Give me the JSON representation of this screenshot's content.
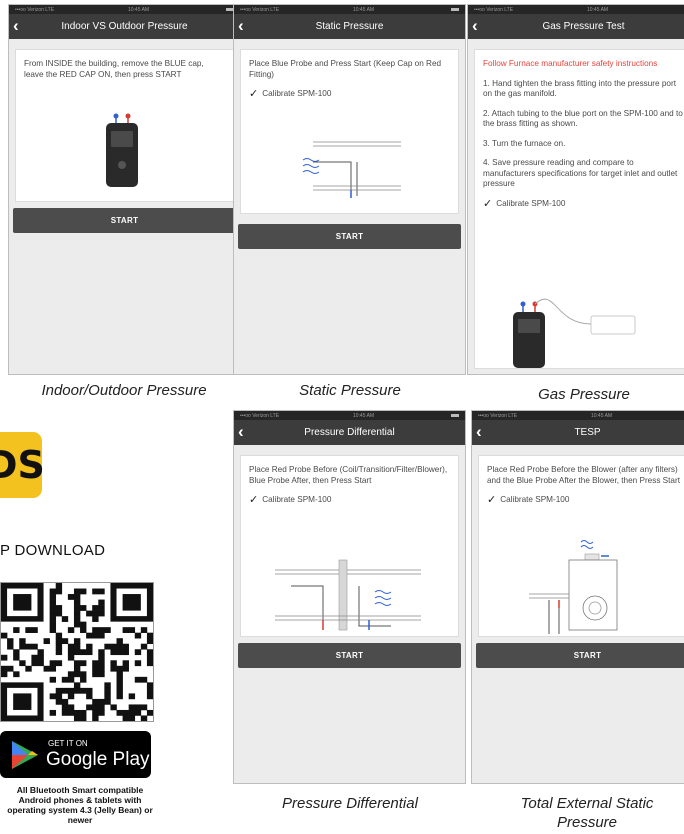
{
  "status_bar": {
    "carrier": "•••oo Verizon LTE",
    "time": "10:45 AM",
    "battery": "∗"
  },
  "screens": {
    "indoor_outdoor": {
      "title": "Indoor VS Outdoor Pressure",
      "instruction": "From INSIDE the building, remove the BLUE cap, leave the RED CAP ON, then press START",
      "button": "START",
      "caption": "Indoor/Outdoor Pressure"
    },
    "static_pressure": {
      "title": "Static Pressure",
      "instruction": "Place Blue Probe and Press Start (Keep Cap on Red Fitting)",
      "calibrate": "Calibrate SPM-100",
      "button": "START",
      "caption": "Static Pressure"
    },
    "gas_pressure": {
      "title": "Gas Pressure Test",
      "warning": "Follow Furnace manufacturer safety instructions",
      "steps": [
        "1. Hand tighten the brass fitting into the pressure port on the gas manifold.",
        "2. Attach tubing to the blue port on the SPM-100 and to the brass fitting as shown.",
        "3. Turn the furnace on.",
        "4. Save pressure reading and compare to manufacturers specifications for target inlet and outlet pressure"
      ],
      "calibrate": "Calibrate SPM-100",
      "caption": "Gas Pressure"
    },
    "pressure_differential": {
      "title": "Pressure Differential",
      "instruction": "Place Red Probe Before (Coil/Transition/Filter/Blower), Blue Probe After, then Press Start",
      "calibrate": "Calibrate SPM-100",
      "button": "START",
      "caption": "Pressure Differential"
    },
    "tesp": {
      "title": "TESP",
      "instruction": "Place Red Probe Before the Blower (after any filters) and the Blue Probe After the Blower, then Press Start",
      "calibrate": "Calibrate SPM-100",
      "button": "START",
      "caption_line1": "Total External Static",
      "caption_line2": "Pressure"
    }
  },
  "download": {
    "badge_text": "DS",
    "heading": "P DOWNLOAD",
    "google_play_small": "GET IT ON",
    "google_play_big": "Google Play",
    "compat_text": "All Bluetooth Smart compatible Android phones & tablets with operating system 4.3 (Jelly Bean) or",
    "compat_tail": "newer"
  },
  "colors": {
    "nav": "#3c3c3c",
    "button": "#4c4c4c",
    "warning": "#e2443b",
    "badge": "#f4c21f",
    "blue_probe": "#2f5fd1",
    "red_probe": "#d63a32"
  }
}
